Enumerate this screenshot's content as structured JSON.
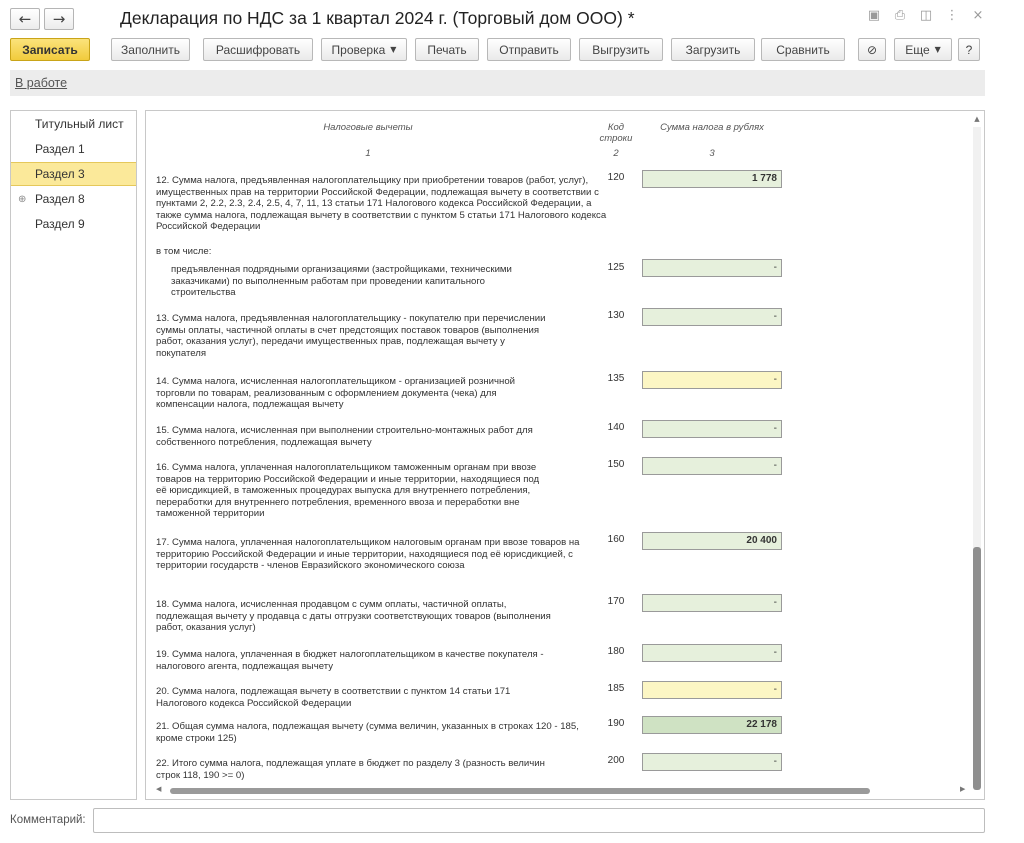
{
  "window": {
    "title": "Декларация по НДС за 1 квартал 2024 г. (Торговый дом ООО) *",
    "back_glyph": "←",
    "forward_glyph": "→",
    "icons": [
      "save-icon",
      "print-icon",
      "preview-icon",
      "more-vert-icon",
      "close-icon"
    ],
    "icon_glyphs": {
      "save": "▣",
      "print": "⎙",
      "preview": "◫",
      "more": "⋮",
      "close": "×"
    }
  },
  "toolbar": {
    "buttons": [
      {
        "label": "Записать",
        "primary": true
      },
      {
        "label": "Заполнить"
      },
      {
        "label": "Расшифровать"
      },
      {
        "label": "Проверка",
        "dropdown": true
      },
      {
        "label": "Печать"
      },
      {
        "label": "Отправить"
      },
      {
        "label": "Выгрузить"
      },
      {
        "label": "Загрузить"
      },
      {
        "label": "Сравнить"
      },
      {
        "label": "",
        "icon": "attachment-icon",
        "glyph": "⊘"
      },
      {
        "label": "Еще",
        "dropdown": true
      },
      {
        "label": "?"
      }
    ]
  },
  "status": {
    "label": "В работе"
  },
  "sidebar": {
    "items": [
      {
        "label": "Титульный лист",
        "active": false,
        "expandable": false
      },
      {
        "label": "Раздел 1",
        "active": false,
        "expandable": false
      },
      {
        "label": "Раздел 3",
        "active": true,
        "expandable": false
      },
      {
        "label": "Раздел 8",
        "active": false,
        "expandable": true
      },
      {
        "label": "Раздел 9",
        "active": false,
        "expandable": false
      }
    ],
    "expand_glyph": "⊕"
  },
  "table": {
    "headers": {
      "col1": "Налоговые вычеты",
      "col1_num": "1",
      "col2": "Код строки",
      "col2_num": "2",
      "col3": "Сумма налога в рублях",
      "col3_num": "3"
    },
    "sub_caption": "в том числе:",
    "rows": [
      {
        "text": "12. Сумма налога, предъявленная налогоплательщику при приобретении товаров (работ, услуг), имущественных прав на территории Российской Федерации, подлежащая вычету в соответствии с пунктами 2, 2.2, 2.3, 2.4, 2.5, 4, 7, 11, 13 статьи 171 Налогового кодекса Российской Федерации, а также сумма налога, подлежащая вычету в соответствии с пунктом 5 статьи 171 Налогового кодекса Российской Федерации",
        "code": "120",
        "value": "1 778",
        "style": "green",
        "bold": true
      },
      {
        "text": "предъявленная подрядными организациями (застройщиками, техническими заказчиками) по выполненным работам при проведении капитального строительства",
        "code": "125",
        "value": "-",
        "style": "green",
        "bold": false
      },
      {
        "text": "13. Сумма налога, предъявленная налогоплательщику - покупателю при перечислении суммы оплаты, частичной оплаты в счет предстоящих поставок товаров (выполнения работ, оказания услуг), передачи имущественных прав, подлежащая вычету у покупателя",
        "code": "130",
        "value": "-",
        "style": "green",
        "bold": false
      },
      {
        "text": "14. Сумма налога, исчисленная налогоплательщиком - организацией розничной торговли по товарам, реализованным с оформлением документа (чека) для компенсации налога, подлежащая вычету",
        "code": "135",
        "value": "-",
        "style": "yellow",
        "bold": false
      },
      {
        "text": "15. Сумма налога, исчисленная при выполнении строительно-монтажных работ для собственного потребления, подлежащая вычету",
        "code": "140",
        "value": "-",
        "style": "green",
        "bold": false
      },
      {
        "text": "16. Сумма налога, уплаченная налогоплательщиком таможенным органам при ввозе товаров на территорию Российской Федерации и иные территории, находящиеся под её юрисдикцией, в таможенных процедурах выпуска для внутреннего потребления, переработки для внутреннего потребления, временного ввоза и переработки вне таможенной территории",
        "code": "150",
        "value": "-",
        "style": "green",
        "bold": false
      },
      {
        "text": "17. Сумма налога, уплаченная налогоплательщиком налоговым органам при ввозе товаров на территорию Российской Федерации и иные территории, находящиеся под её юрисдикцией, с территории государств - членов Евразийского экономического союза",
        "code": "160",
        "value": "20 400",
        "style": "green",
        "bold": true
      },
      {
        "text": "18. Сумма налога, исчисленная продавцом с сумм оплаты, частичной оплаты, подлежащая вычету у продавца с даты отгрузки соответствующих товаров (выполнения работ, оказания услуг)",
        "code": "170",
        "value": "-",
        "style": "green",
        "bold": false
      },
      {
        "text": "19. Сумма налога, уплаченная в бюджет налогоплательщиком в качестве покупателя - налогового агента, подлежащая вычету",
        "code": "180",
        "value": "-",
        "style": "green",
        "bold": false
      },
      {
        "text": "20. Сумма налога, подлежащая вычету в соответствии с пунктом 14 статьи 171 Налогового кодекса Российской Федерации",
        "code": "185",
        "value": "-",
        "style": "yellow",
        "bold": false
      },
      {
        "text": "21. Общая сумма налога, подлежащая вычету (сумма величин, указанных в строках 120 - 185, кроме строки 125)",
        "code": "190",
        "value": "22 178",
        "style": "total",
        "bold": true
      },
      {
        "text": "22. Итого сумма налога, подлежащая уплате в бюджет по разделу 3 (разность величин строк 118, 190 >= 0)",
        "code": "200",
        "value": "-",
        "style": "green",
        "bold": false
      }
    ]
  },
  "comment": {
    "label": "Комментарий:",
    "value": ""
  },
  "scroll": {
    "up_glyph": "▲",
    "down_glyph": "▼",
    "left_glyph": "◀",
    "right_glyph": "▶"
  }
}
